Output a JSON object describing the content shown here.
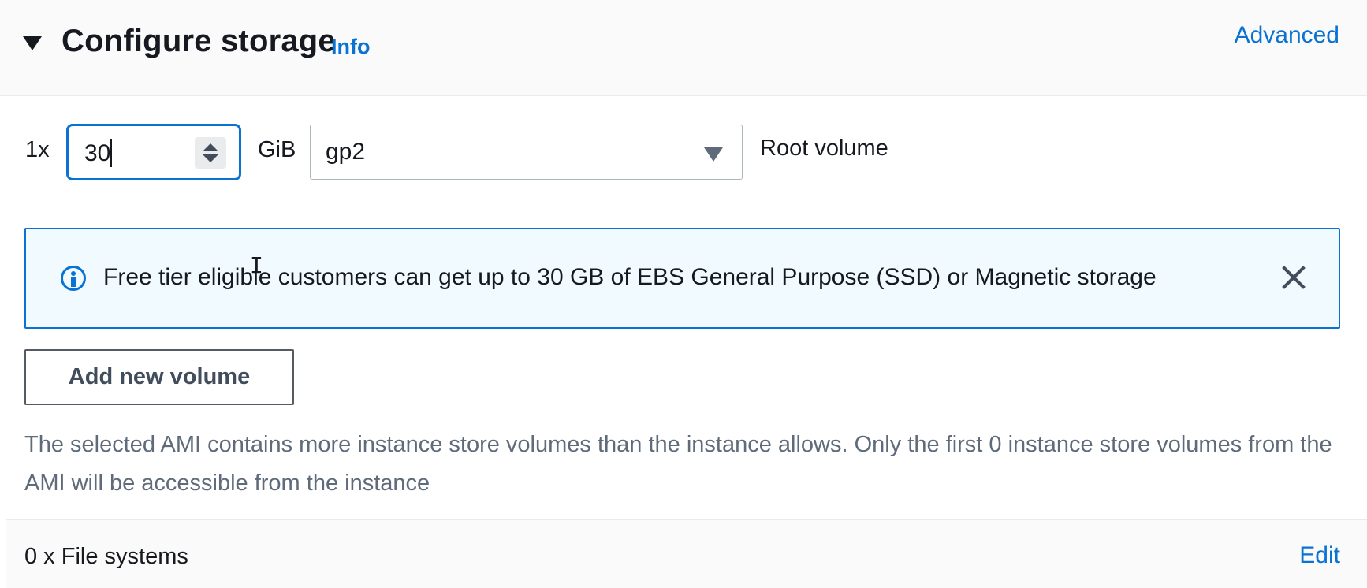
{
  "header": {
    "title": "Configure storage",
    "info_link": "Info",
    "advanced_link": "Advanced"
  },
  "volume_row": {
    "count_label": "1x",
    "size_value": "30",
    "unit_label": "GiB",
    "volume_type": "gp2",
    "role_label": "Root volume"
  },
  "alert": {
    "message": "Free tier eligible customers can get up to 30 GB of EBS General Purpose (SSD) or Magnetic storage"
  },
  "add_volume_button": "Add new volume",
  "ami_note": "The selected AMI contains more instance store volumes than the instance allows. Only the first 0 instance store volumes from the AMI will be accessible from the instance",
  "file_systems": {
    "label": "0 x File systems",
    "edit_link": "Edit"
  },
  "icons": {
    "collapse": "caret-down-icon",
    "stepper": "number-stepper-icon",
    "dropdown": "chevron-down-icon",
    "info": "info-circle-icon",
    "close": "close-icon",
    "cursor": "text-cursor-icon"
  },
  "colors": {
    "link": "#0972d3",
    "focus_border": "#0972d3",
    "alert_background": "#f1faff",
    "text_primary": "#16191f",
    "text_secondary": "#5f6b7a"
  }
}
